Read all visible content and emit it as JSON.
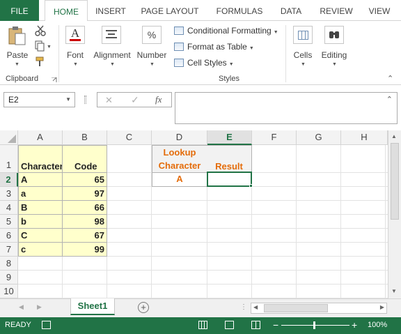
{
  "ribbon_tabs": [
    "FILE",
    "HOME",
    "INSERT",
    "PAGE LAYOUT",
    "FORMULAS",
    "DATA",
    "REVIEW",
    "VIEW"
  ],
  "active_tab": "HOME",
  "clipboard": {
    "paste_label": "Paste",
    "group_label": "Clipboard"
  },
  "font": {
    "label": "Font"
  },
  "alignment": {
    "label": "Alignment"
  },
  "number": {
    "label": "Number",
    "icon_glyph": "%"
  },
  "styles": {
    "conditional_formatting": "Conditional Formatting",
    "format_as_table": "Format as Table",
    "cell_styles": "Cell Styles",
    "group_label": "Styles"
  },
  "cells": {
    "label": "Cells"
  },
  "editing": {
    "label": "Editing"
  },
  "formula_bar": {
    "name_box": "E2",
    "cancel_glyph": "✕",
    "enter_glyph": "✓",
    "fx_glyph": "fx",
    "formula": ""
  },
  "columns": [
    "A",
    "B",
    "C",
    "D",
    "E",
    "F",
    "G",
    "H"
  ],
  "rows": [
    "1",
    "2",
    "3",
    "4",
    "5",
    "6",
    "7",
    "8",
    "9",
    "10"
  ],
  "selected_cell": "E2",
  "table": {
    "headers": [
      "Character",
      "Code"
    ],
    "rows": [
      [
        "A",
        "65"
      ],
      [
        "a",
        "97"
      ],
      [
        "B",
        "66"
      ],
      [
        "b",
        "98"
      ],
      [
        "C",
        "67"
      ],
      [
        "c",
        "99"
      ]
    ]
  },
  "lookup": {
    "header_line1": "Lookup",
    "header_line2": "Character",
    "result_header": "Result",
    "value": "A"
  },
  "sheet_tab": "Sheet1",
  "status": {
    "mode": "READY",
    "zoom": "100%",
    "zoom_minus": "−",
    "zoom_plus": "+"
  },
  "colors": {
    "excel_green": "#217346",
    "lookup_orange": "#e46c0a",
    "table_fill": "#ffffcc"
  }
}
